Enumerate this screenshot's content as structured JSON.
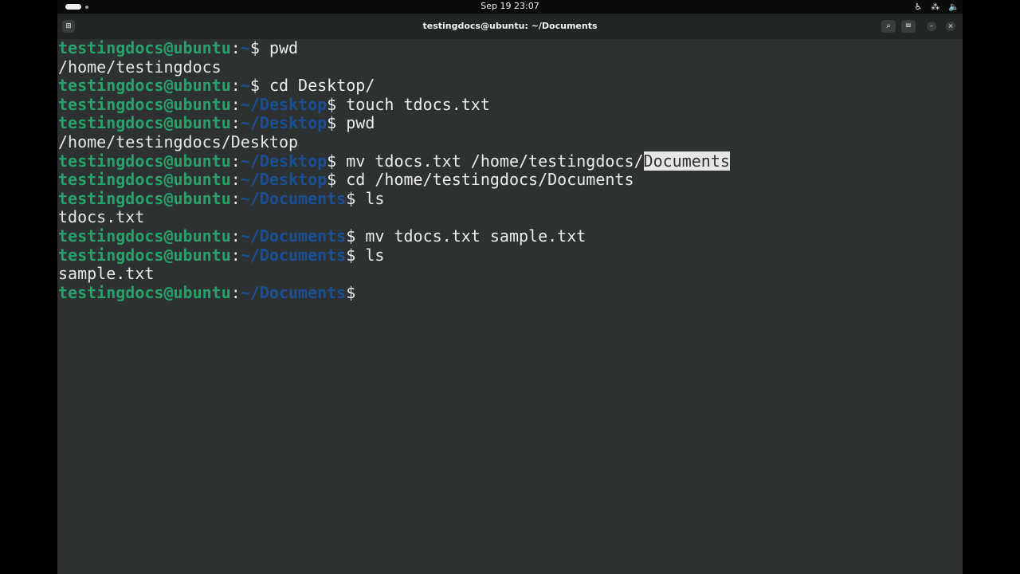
{
  "topbar": {
    "clock": "Sep 19  23:07",
    "tray_icons": [
      "accessibility-icon",
      "network-icon",
      "volume-icon"
    ]
  },
  "titlebar": {
    "title": "testingdocs@ubuntu: ~/Documents",
    "buttons": [
      "new-tab-icon",
      "search-icon",
      "hamburger-menu-icon",
      "minimize-icon",
      "close-icon"
    ]
  },
  "terminal": {
    "colors": {
      "user": "#26a269",
      "path": "#1b4f94",
      "text": "#e8e8e8",
      "background": "#2d3132"
    },
    "lines": [
      {
        "type": "prompt",
        "user": "testingdocs@ubuntu",
        "sep": ":",
        "path": "~",
        "dollar": "$ ",
        "cmd": "pwd"
      },
      {
        "type": "output",
        "text": "/home/testingdocs"
      },
      {
        "type": "prompt",
        "user": "testingdocs@ubuntu",
        "sep": ":",
        "path": "~",
        "dollar": "$ ",
        "cmd": "cd Desktop/"
      },
      {
        "type": "prompt",
        "user": "testingdocs@ubuntu",
        "sep": ":",
        "path": "~/Desktop",
        "dollar": "$ ",
        "cmd": "touch tdocs.txt"
      },
      {
        "type": "prompt",
        "user": "testingdocs@ubuntu",
        "sep": ":",
        "path": "~/Desktop",
        "dollar": "$ ",
        "cmd": "pwd"
      },
      {
        "type": "output",
        "text": "/home/testingdocs/Desktop"
      },
      {
        "type": "prompt",
        "user": "testingdocs@ubuntu",
        "sep": ":",
        "path": "~/Desktop",
        "dollar": "$ ",
        "cmd": "mv tdocs.txt /home/testingdocs/",
        "selected": "Documents"
      },
      {
        "type": "prompt",
        "user": "testingdocs@ubuntu",
        "sep": ":",
        "path": "~/Desktop",
        "dollar": "$ ",
        "cmd": "cd /home/testingdocs/Documents"
      },
      {
        "type": "prompt",
        "user": "testingdocs@ubuntu",
        "sep": ":",
        "path": "~/Documents",
        "dollar": "$ ",
        "cmd": "ls"
      },
      {
        "type": "output",
        "text": "tdocs.txt"
      },
      {
        "type": "prompt",
        "user": "testingdocs@ubuntu",
        "sep": ":",
        "path": "~/Documents",
        "dollar": "$ ",
        "cmd": "mv tdocs.txt sample.txt"
      },
      {
        "type": "prompt",
        "user": "testingdocs@ubuntu",
        "sep": ":",
        "path": "~/Documents",
        "dollar": "$ ",
        "cmd": "ls"
      },
      {
        "type": "output",
        "text": "sample.txt"
      },
      {
        "type": "prompt",
        "user": "testingdocs@ubuntu",
        "sep": ":",
        "path": "~/Documents",
        "dollar": "$ ",
        "cmd": ""
      }
    ]
  }
}
